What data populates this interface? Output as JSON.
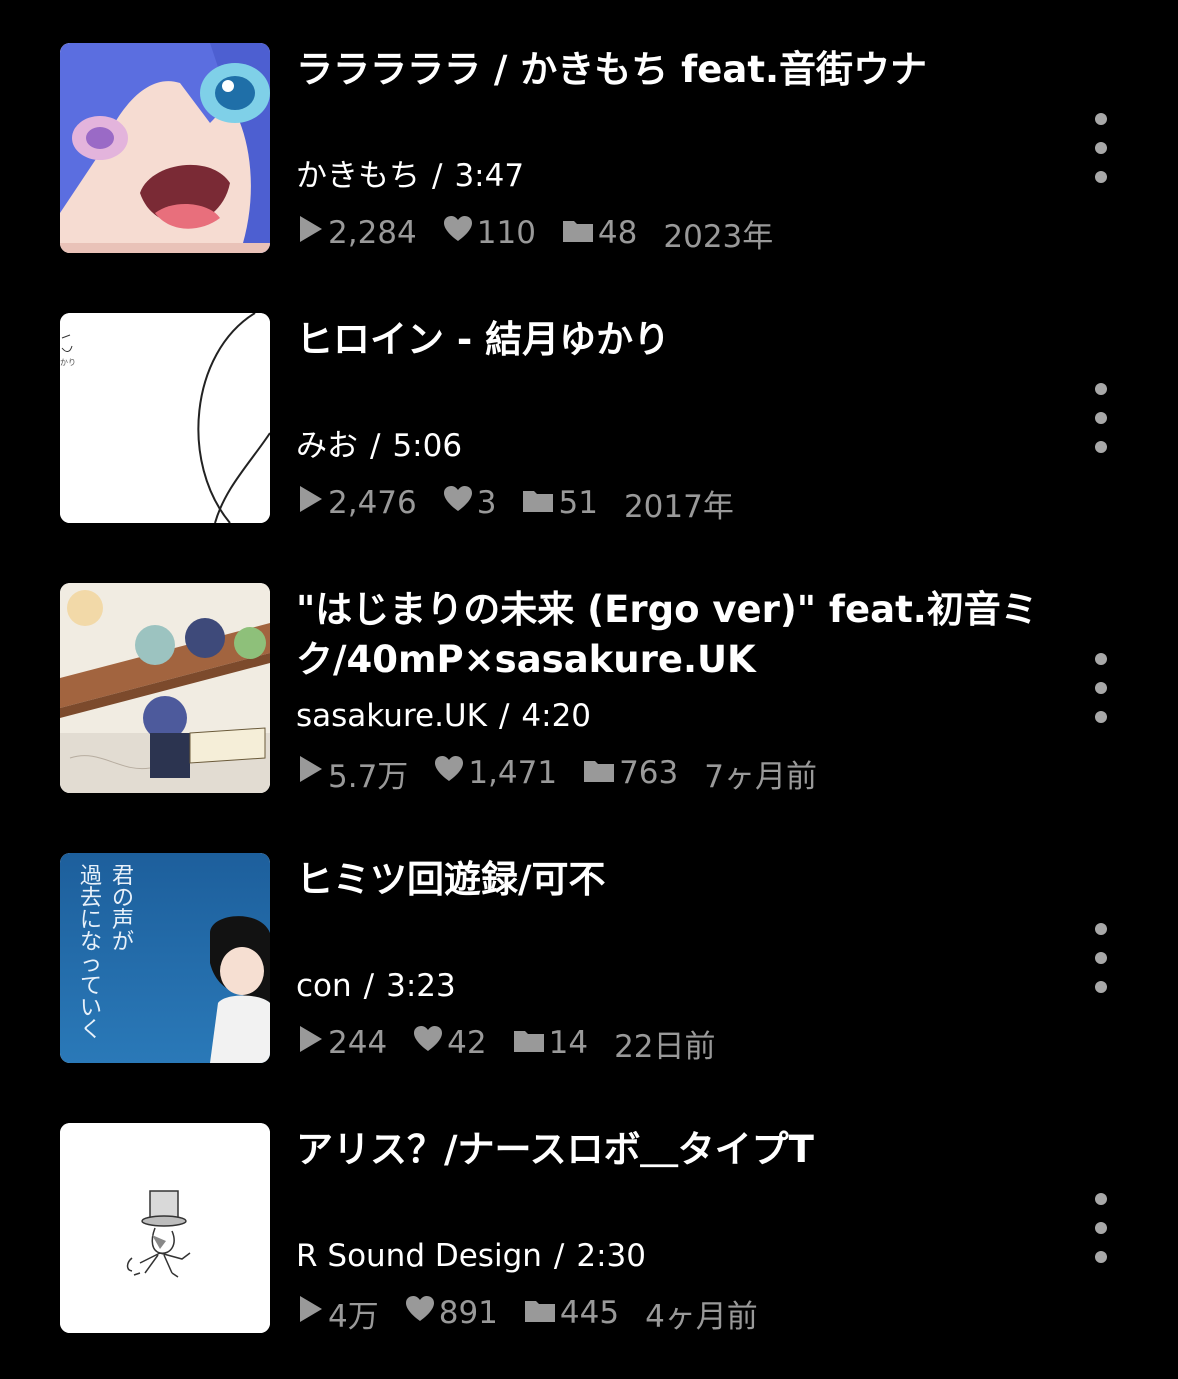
{
  "items": [
    {
      "title": "ラララララ / かきもち feat.音街ウナ",
      "uploader": "かきもち",
      "duration": "3:47",
      "plays": "2,284",
      "likes": "110",
      "mylists": "48",
      "date": "2023年",
      "thumb": "anime-girl-blue-hair"
    },
    {
      "title": "ヒロイン - 結月ゆかり",
      "uploader": "みお",
      "duration": "5:06",
      "plays": "2,476",
      "likes": "3",
      "mylists": "51",
      "date": "2017年",
      "thumb": "white-line-art"
    },
    {
      "title": "\"はじまりの未来 (Ergo ver)\" feat.初音ミク/40mP×sasakure.UK",
      "uploader": "sasakure.UK",
      "duration": "4:20",
      "plays": "5.7万",
      "likes": "1,471",
      "mylists": "763",
      "date": "7ヶ月前",
      "thumb": "characters-on-bench"
    },
    {
      "title": "ヒミツ回遊録/可不",
      "uploader": "con",
      "duration": "3:23",
      "plays": "244",
      "likes": "42",
      "mylists": "14",
      "date": "22日前",
      "thumb": "blue-poster-girl",
      "thumb_text": "君の声が過去になっていく"
    },
    {
      "title": "アリス？/ナースロボ＿タイプT",
      "uploader": "R Sound Design",
      "duration": "2:30",
      "plays": "4万",
      "likes": "891",
      "mylists": "445",
      "date": "4ヶ月前",
      "thumb": "mad-hatter-sketch"
    }
  ],
  "icons": {
    "play": "play-icon",
    "like": "heart-icon",
    "mylist": "folder-icon",
    "more": "more-vertical-icon"
  },
  "colors": {
    "background": "#000000",
    "text": "#ffffff",
    "muted": "#999999"
  }
}
